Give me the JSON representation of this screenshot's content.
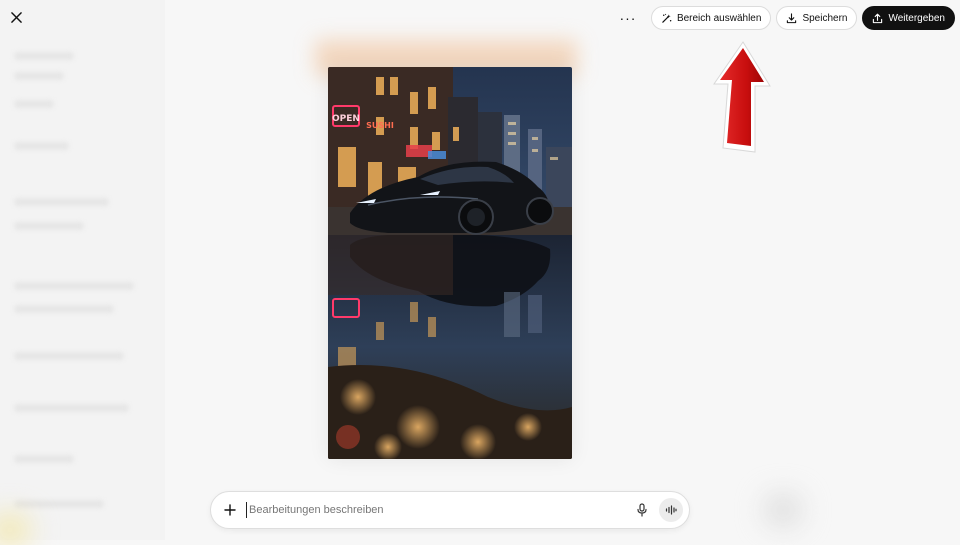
{
  "toolbar": {
    "more_label": "···",
    "select_area_label": "Bereich auswählen",
    "save_label": "Speichern",
    "share_label": "Weitergeben"
  },
  "composer": {
    "placeholder": "Bearbeitungen beschreiben"
  },
  "image": {
    "neon_sign_1": "OPEN",
    "neon_sign_2": "SUSHI"
  },
  "colors": {
    "accent_dark": "#111111",
    "annotation_arrow": "#d21010"
  }
}
